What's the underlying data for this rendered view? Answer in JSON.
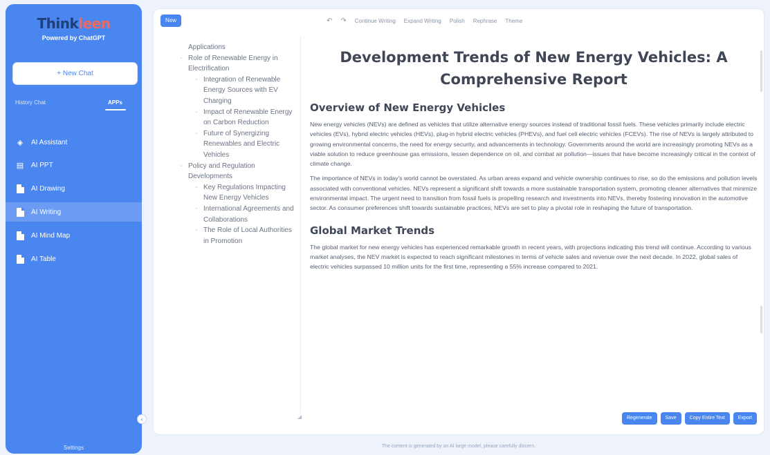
{
  "sidebar": {
    "logo_part1": "Think",
    "logo_part2": "leen",
    "powered_by": "Powered by ChatGPT",
    "new_chat": "+ New Chat",
    "tab_history": "History Chat",
    "tab_apps": "APPs",
    "items": [
      {
        "label": "AI Assistant",
        "icon": "robot-icon"
      },
      {
        "label": "AI PPT",
        "icon": "slides-icon"
      },
      {
        "label": "AI Drawing",
        "icon": "doc-icon"
      },
      {
        "label": "AI Writing",
        "icon": "doc-icon"
      },
      {
        "label": "AI Mind Map",
        "icon": "doc-icon"
      },
      {
        "label": "AI Table",
        "icon": "doc-icon"
      }
    ],
    "settings": "Settings",
    "brand_color": "#4a86f0"
  },
  "toolbar": {
    "new_label": "New",
    "continue": "Continue Writing",
    "expand": "Expand Writing",
    "polish": "Polish",
    "rephrase": "Rephrase",
    "theme": "Theme"
  },
  "outline": [
    {
      "text": "Applications",
      "level": "cont"
    },
    {
      "text": "Role of Renewable Energy in Electrification",
      "level": "lvl1"
    },
    {
      "text": "Integration of Renewable Energy Sources with EV Charging",
      "level": "lvl2"
    },
    {
      "text": "Impact of Renewable Energy on Carbon Reduction",
      "level": "lvl2"
    },
    {
      "text": "Future of Synergizing Renewables and Electric Vehicles",
      "level": "lvl2"
    },
    {
      "text": "Policy and Regulation Developments",
      "level": "lvl1"
    },
    {
      "text": "Key Regulations Impacting New Energy Vehicles",
      "level": "lvl2"
    },
    {
      "text": "International Agreements and Collaborations",
      "level": "lvl2"
    },
    {
      "text": "The Role of Local Authorities in Promotion",
      "level": "lvl2"
    }
  ],
  "document": {
    "title": "Development Trends of New Energy Vehicles: A Comprehensive Report",
    "h_overview": "Overview of New Energy Vehicles",
    "p1": "New energy vehicles (NEVs) are defined as vehicles that utilize alternative energy sources instead of traditional fossil fuels. These vehicles primarily include electric vehicles (EVs), hybrid electric vehicles (HEVs), plug-in hybrid electric vehicles (PHEVs), and fuel cell electric vehicles (FCEVs). The rise of NEVs is largely attributed to growing environmental concerns, the need for energy security, and advancements in technology. Governments around the world are increasingly promoting NEVs as a viable solution to reduce greenhouse gas emissions, lessen dependence on oil, and combat air pollution—issues that have become increasingly critical in the context of climate change.",
    "p2": "The importance of NEVs in today's world cannot be overstated. As urban areas expand and vehicle ownership continues to rise, so do the emissions and pollution levels associated with conventional vehicles. NEVs represent a significant shift towards a more sustainable transportation system, promoting cleaner alternatives that minimize environmental impact. The urgent need to transition from fossil fuels is propelling research and investments into NEVs, thereby fostering innovation in the automotive sector. As consumer preferences shift towards sustainable practices, NEVs are set to play a pivotal role in reshaping the future of transportation.",
    "h_global": "Global Market Trends",
    "p3": "The global market for new energy vehicles has experienced remarkable growth in recent years, with projections indicating this trend will continue. According to various market analyses, the NEV market is expected to reach significant milestones in terms of vehicle sales and revenue over the next decade. In 2022, global sales of electric vehicles surpassed 10 million units for the first time, representing a 55% increase compared to 2021."
  },
  "actions": {
    "regenerate": "Regenerate",
    "save": "Save",
    "copy": "Copy Entire Text",
    "export": "Export"
  },
  "footer": "The content is generated by an AI large model, please carefully discern."
}
